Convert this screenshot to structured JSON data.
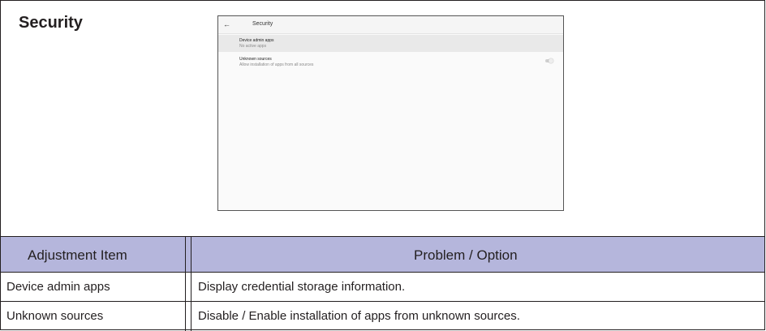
{
  "section": {
    "title": "Security"
  },
  "screen": {
    "back_icon": "←",
    "title": "Security",
    "items": [
      {
        "title": "Device admin apps",
        "subtitle": "No active apps"
      },
      {
        "title": "Unknown sources",
        "subtitle": "Allow installation of apps from all sources",
        "toggle": "off"
      }
    ]
  },
  "table": {
    "headers": [
      "Adjustment Item",
      "Problem / Option"
    ],
    "rows": [
      [
        "Device admin apps",
        "Display credential storage information."
      ],
      [
        "Unknown sources",
        "Disable / Enable installation of apps from unknown sources."
      ]
    ]
  },
  "colors": {
    "header_bg": "#b5b6dc"
  }
}
